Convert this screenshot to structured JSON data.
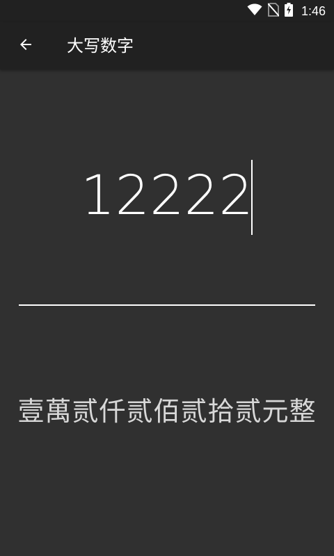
{
  "status_bar": {
    "time": "1:46",
    "icons": [
      "wifi-icon",
      "no-sim-icon",
      "battery-charging-icon"
    ]
  },
  "app_bar": {
    "back_icon": "arrow-back-icon",
    "title": "大写数字"
  },
  "input": {
    "value": "12222"
  },
  "result": {
    "text": "壹萬贰仟贰佰贰拾贰元整"
  },
  "colors": {
    "background": "#303030",
    "app_bar": "#212121",
    "text_primary": "#ffffff",
    "text_result": "#d8d8d8"
  }
}
